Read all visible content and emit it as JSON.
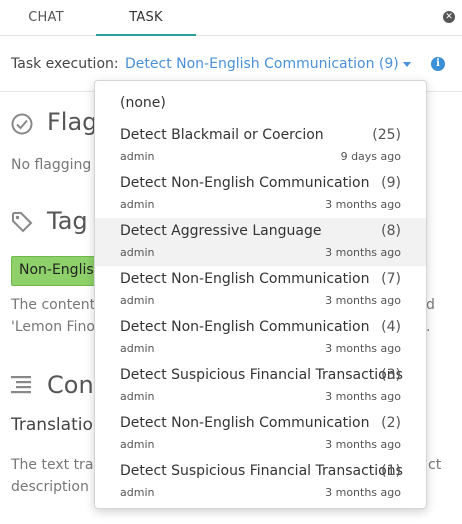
{
  "tabs": {
    "chat": "CHAT",
    "task": "TASK"
  },
  "icons": {
    "close": "close-circle-icon",
    "info": "info-icon",
    "flag": "check-circle-icon",
    "tag": "tag-icon",
    "content": "lines-icon"
  },
  "task_execution": {
    "label": "Task execution:",
    "selected": "Detect Non-English Communication (9)"
  },
  "background": {
    "flag_title": "Flag",
    "flag_text": "No flagging",
    "tags_title": "Tag",
    "tag_chip": "Non-Englis",
    "tags_text_1": "The content",
    "tags_text_2": "'Lemon Fino'",
    "tags_text_right_1": "d",
    "tags_text_right_2": ".",
    "content_title": "Con",
    "translation_title": "Translatio",
    "content_text_1": "The text tran",
    "content_text_2": "description i",
    "content_text_right_1": "ct"
  },
  "dropdown": {
    "none_label": "(none)",
    "options": [
      {
        "name": "Detect Blackmail or Coercion",
        "count": "(25)",
        "user": "admin",
        "age": "9 days ago"
      },
      {
        "name": "Detect Non-English Communication",
        "count": "(9)",
        "user": "admin",
        "age": "3 months ago"
      },
      {
        "name": "Detect Aggressive Language",
        "count": "(8)",
        "user": "admin",
        "age": "3 months ago"
      },
      {
        "name": "Detect Non-English Communication",
        "count": "(7)",
        "user": "admin",
        "age": "3 months ago"
      },
      {
        "name": "Detect Non-English Communication",
        "count": "(4)",
        "user": "admin",
        "age": "3 months ago"
      },
      {
        "name": "Detect Suspicious Financial Transactions",
        "count": "(3)",
        "user": "admin",
        "age": "3 months ago"
      },
      {
        "name": "Detect Non-English Communication",
        "count": "(2)",
        "user": "admin",
        "age": "3 months ago"
      },
      {
        "name": "Detect Suspicious Financial Transactions",
        "count": "(1)",
        "user": "admin",
        "age": "3 months ago"
      }
    ]
  },
  "colors": {
    "accent": "#4a90d9",
    "tab_underline": "#2aa198",
    "tag_green": "#8ed16a",
    "highlight": "#f2f2f2"
  }
}
